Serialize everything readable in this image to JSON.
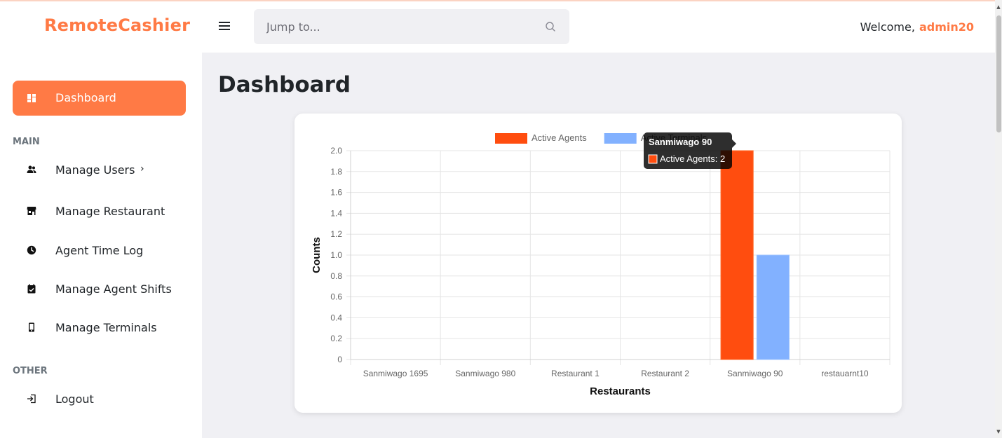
{
  "header": {
    "brand": "RemoteCashier",
    "search_placeholder": "Jump to...",
    "welcome_label": "Welcome,",
    "username": "admin20"
  },
  "sidebar": {
    "active": {
      "label": "Dashboard",
      "icon": "dashboard-icon"
    },
    "sections": [
      {
        "title": "MAIN",
        "items": [
          {
            "label": "Manage Users",
            "icon": "users-icon",
            "has_submenu": true
          },
          {
            "label": "Manage Restaurant",
            "icon": "store-icon"
          },
          {
            "label": "Agent Time Log",
            "icon": "clock-icon"
          },
          {
            "label": "Manage Agent Shifts",
            "icon": "calendar-check-icon"
          },
          {
            "label": "Manage Terminals",
            "icon": "mobile-icon"
          }
        ]
      },
      {
        "title": "OTHER",
        "items": [
          {
            "label": "Logout",
            "icon": "logout-icon"
          }
        ]
      }
    ]
  },
  "main": {
    "title": "Dashboard"
  },
  "colors": {
    "accent": "#ff7a45",
    "active_agents": "#ff4d0f",
    "active_terminals": "#82b1ff"
  },
  "chart_data": {
    "type": "bar",
    "categories": [
      "Sanmiwago 1695",
      "Sanmiwago 980",
      "Restaurant 1",
      "Restaurant 2",
      "Sanmiwago 90",
      "restauarnt10"
    ],
    "series": [
      {
        "name": "Active Agents",
        "values": [
          0,
          0,
          0,
          0,
          2,
          0
        ]
      },
      {
        "name": "Active Terminals",
        "values": [
          0,
          0,
          0,
          0,
          1,
          0
        ]
      }
    ],
    "xlabel": "Restaurants",
    "ylabel": "Counts",
    "ylim": [
      0,
      2
    ],
    "yticks": [
      "0",
      "0.2",
      "0.4",
      "0.6",
      "0.8",
      "1.0",
      "1.2",
      "1.4",
      "1.6",
      "1.8",
      "2.0"
    ],
    "legend": "top",
    "grid": true,
    "tooltip": {
      "title": "Sanmiwago 90",
      "label": "Active Agents: 2"
    }
  }
}
